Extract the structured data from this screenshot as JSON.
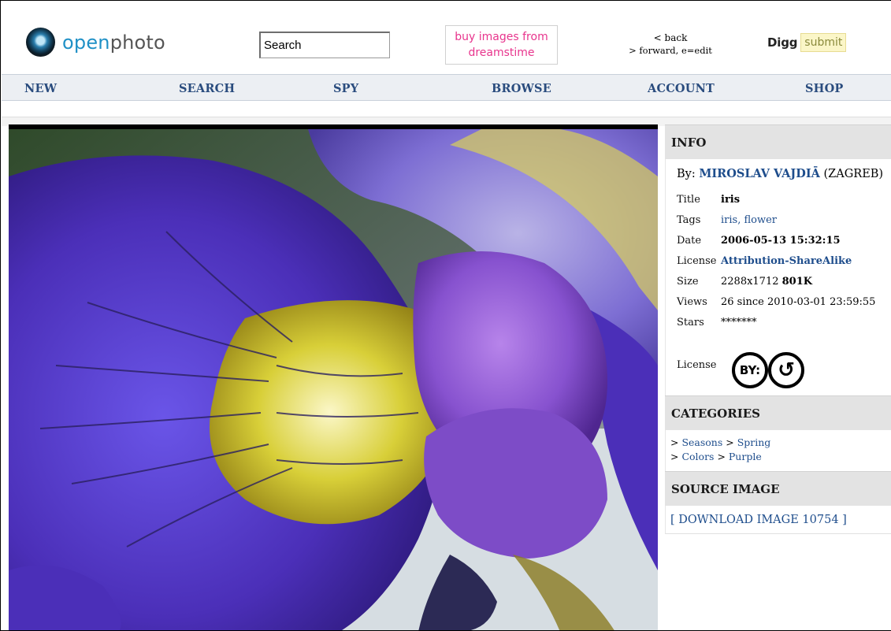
{
  "header": {
    "logo_open": "open",
    "logo_photo": "photo",
    "search_value": "Search",
    "ad_line1": "buy images from",
    "ad_line2": "dreamstime",
    "history_back": "< back",
    "history_forward": "> forward, e=edit",
    "digg_label": "Digg",
    "digg_submit": "submit"
  },
  "nav": {
    "items": [
      "NEW",
      "SEARCH",
      "SPY",
      "BROWSE",
      "ACCOUNT",
      "SHOP"
    ]
  },
  "info": {
    "heading": "INFO",
    "by_prefix": "By: ",
    "author": "MIROSLAV VAJDIĀ",
    "location": " (ZAGREB)",
    "title_label": "Title",
    "title_value": "iris",
    "tags_label": "Tags",
    "tags_value": "iris, flower",
    "date_label": "Date",
    "date_value": "2006-05-13 15:32:15",
    "license_label": "License",
    "license_value": "Attribution-ShareAlike",
    "size_label": "Size",
    "size_dims": "2288x1712 ",
    "size_file": "801K",
    "views_label": "Views",
    "views_value": "26 since 2010-03-01 23:59:55",
    "stars_label": "Stars",
    "stars_value": "*******",
    "license_badge_label": "License",
    "cc_by_text": "BY:",
    "cc_sa_text": "↺"
  },
  "categories": {
    "heading": "CATEGORIES",
    "line1_prefix": "> ",
    "line1_cat": "Seasons",
    "line1_sep": " > ",
    "line1_sub": "Spring",
    "line2_prefix": "> ",
    "line2_cat": "Colors",
    "line2_sep": " > ",
    "line2_sub": "Purple"
  },
  "source": {
    "heading": "SOURCE IMAGE",
    "download": "[ DOWNLOAD IMAGE 10754 ]"
  },
  "colors": {
    "link": "#1e4d8c",
    "nav_text": "#2a4c7e",
    "logo_blue": "#1f90c6",
    "ad_pink": "#e8358d",
    "petal_purple": "#4b2fb8"
  }
}
